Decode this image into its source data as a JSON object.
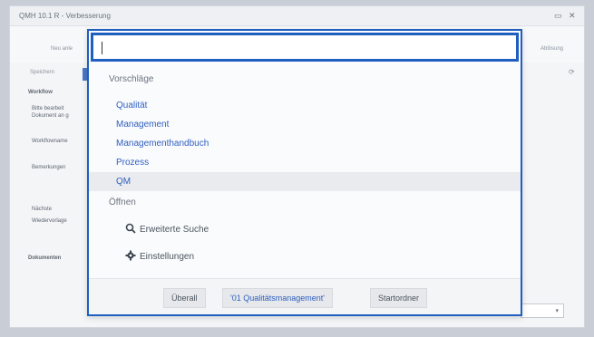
{
  "background": {
    "window_title": "QMH 10.1 R - Verbesserung",
    "toolbar_left_text": "Neu anle",
    "toolbar_right_text": "Ablösung",
    "search_label": "Speichern",
    "sidebar": {
      "workflow_heading": "Workflow",
      "workflow_text_1": "Bitte bearbeit",
      "workflow_text_2": "Dokument an g",
      "workflow_name": "Workflowname",
      "comments": "Bemerkungen",
      "next": "Nächste",
      "resubmission": "Wiedervorlage",
      "documents_heading": "Dokumenten"
    },
    "window_buttons": {
      "minimize": "▭",
      "close": "✕"
    }
  },
  "dropdown": {
    "input_value": "",
    "suggestions_label": "Vorschläge",
    "suggestions": [
      {
        "label": "Qualität"
      },
      {
        "label": "Management"
      },
      {
        "label": "Managementhandbuch"
      },
      {
        "label": "Prozess"
      },
      {
        "label": "QM"
      }
    ],
    "open_label": "Öffnen",
    "open_items": [
      {
        "label": "Erweiterte Suche",
        "icon": "search-icon"
      },
      {
        "label": "Einstellungen",
        "icon": "gear-icon"
      }
    ],
    "scopes": [
      {
        "label": "Überall"
      },
      {
        "label": "'01 Qualitätsmanagement'"
      },
      {
        "label": "Startordner"
      }
    ]
  },
  "colors": {
    "accent": "#1f5fbf",
    "link": "#2f5fc0",
    "selected_row": "#e9ebee"
  }
}
